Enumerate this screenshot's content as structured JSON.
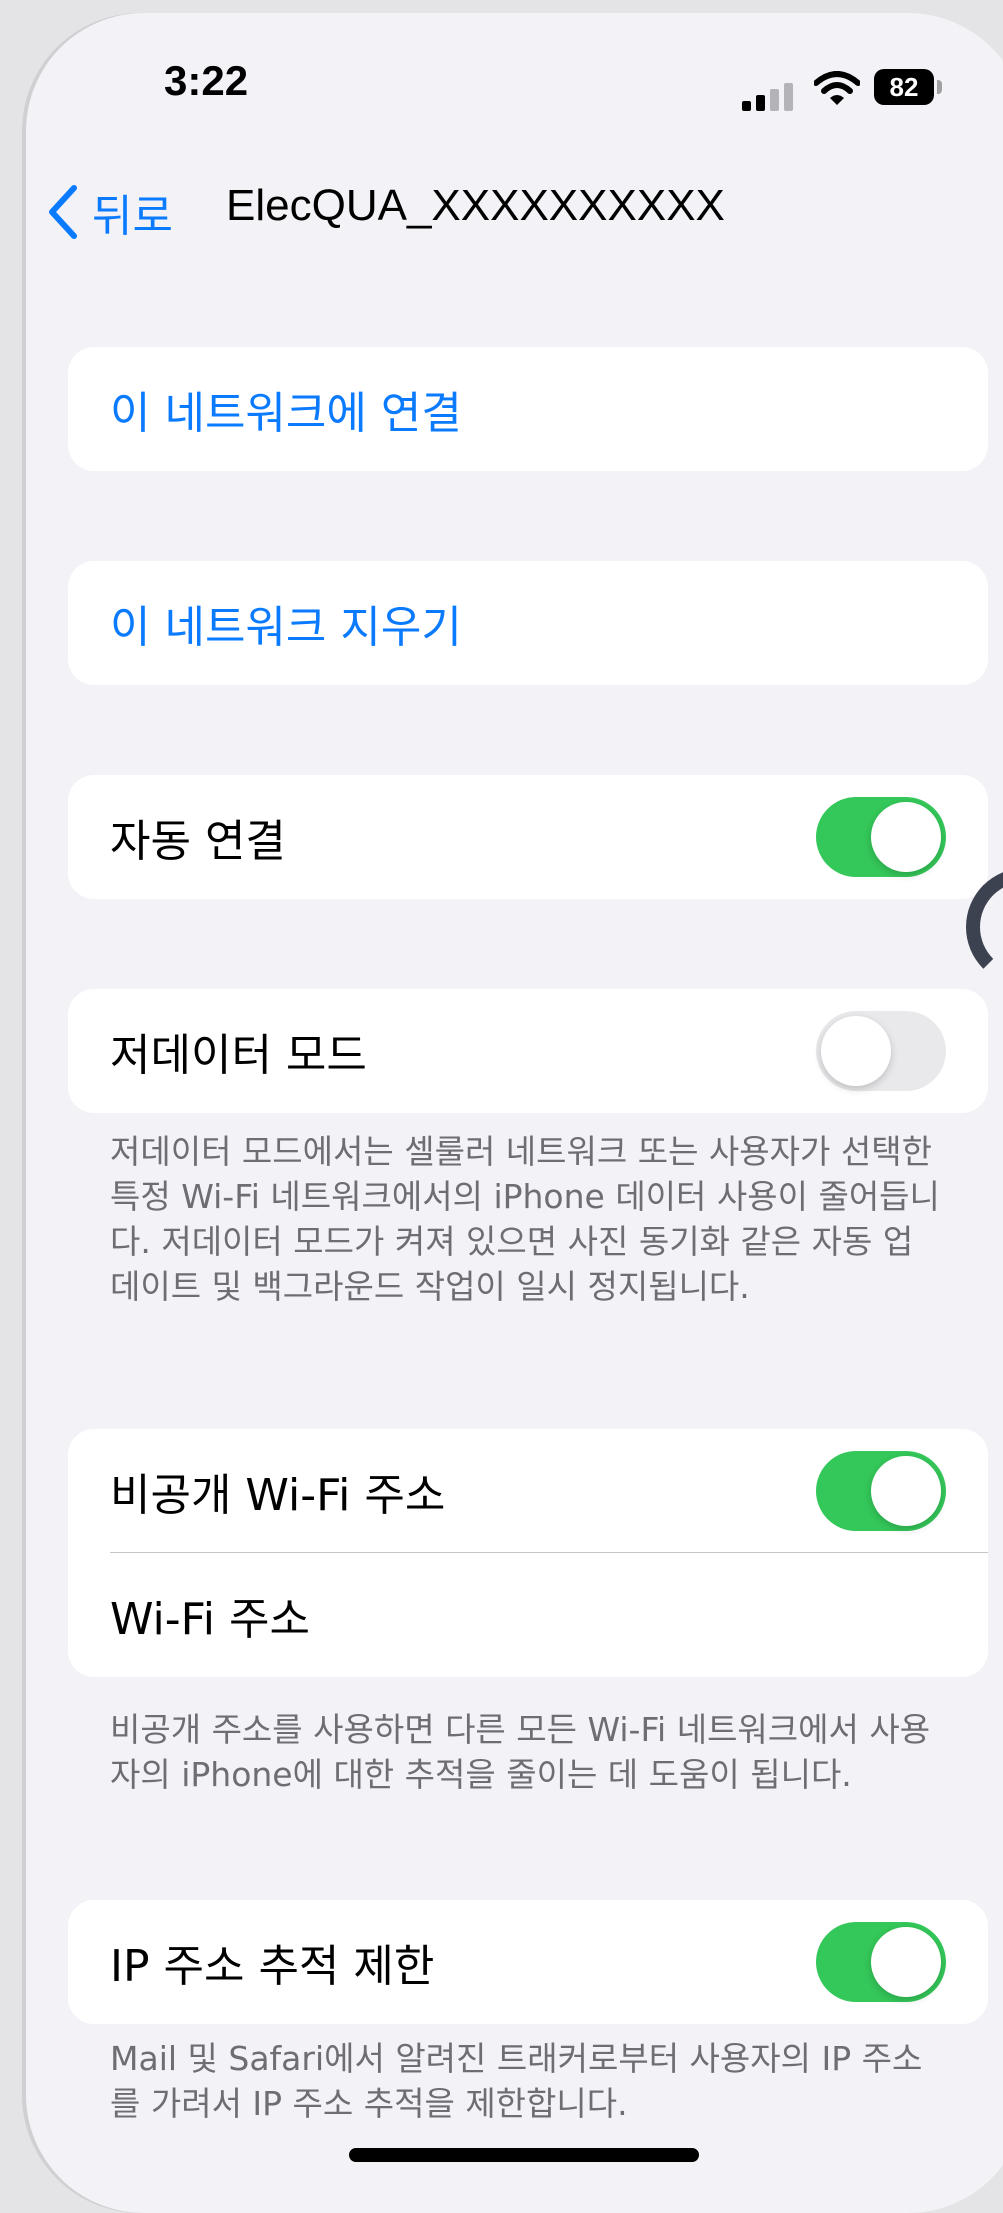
{
  "status_bar": {
    "time": "3:22",
    "battery_percent": "82",
    "signal_icon": "cellular-signal-icon",
    "wifi_icon": "wifi-icon"
  },
  "nav": {
    "back_label": "뒤로",
    "back_icon": "chevron-left-icon",
    "title": "ElecQUA_XXXXXXXXXX"
  },
  "actions": {
    "join": "이 네트워크에 연결",
    "forget": "이 네트워크 지우기"
  },
  "auto_join": {
    "label": "자동 연결",
    "enabled": true
  },
  "low_data": {
    "label": "저데이터 모드",
    "enabled": false,
    "footnote": "저데이터 모드에서는 셀룰러 네트워크 또는 사용자가 선택한 특정 Wi-Fi 네트워크에서의 iPhone 데이터 사용이 줄어듭니다. 저데이터 모드가 켜져 있으면 사진 동기화 같은 자동 업데이트 및 백그라운드 작업이 일시 정지됩니다."
  },
  "private_address": {
    "label": "비공개 Wi-Fi 주소",
    "enabled": true,
    "wifi_address_label": "Wi-Fi 주소",
    "footnote": "비공개 주소를 사용하면 다른 모든 Wi-Fi 네트워크에서 사용자의 iPhone에 대한 추적을 줄이는 데 도움이 됩니다."
  },
  "ip_tracking": {
    "label": "IP 주소 추적 제한",
    "enabled": true,
    "footnote": "Mail 및 Safari에서 알려진 트래커로부터 사용자의 IP 주소를 가려서 IP 주소 추적을 제한합니다."
  },
  "colors": {
    "accent": "#0a7aff",
    "toggle_on": "#34c759",
    "toggle_off": "#e9e9eb",
    "background": "#f2f2f7"
  }
}
